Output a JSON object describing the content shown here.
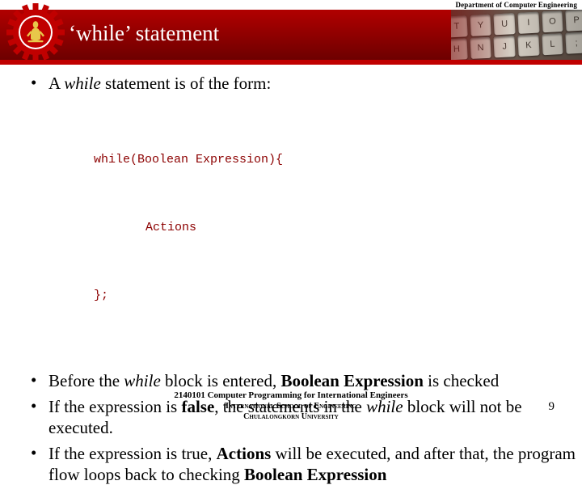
{
  "header": {
    "department": "Department of Computer Engineering",
    "title": "‘while’ statement",
    "keyboard_keys_row1": [
      "T",
      "Y",
      "U",
      "I",
      "O",
      "P"
    ],
    "keyboard_keys_row2": [
      "H",
      "N",
      "J",
      "K",
      "L",
      ";"
    ],
    "band_color": "#8c0000",
    "underline_color": "#c00000"
  },
  "logo": {
    "name": "chulalongkorn-engineering-gear-logo",
    "gear_color": "#c00000",
    "figure_color": "#e8c84a"
  },
  "content": {
    "bullet1": {
      "pre": "A ",
      "em": "while",
      "post": " statement is of the form:"
    },
    "code": {
      "line1_keyword": "while",
      "line1_rest": "(Boolean Expression){",
      "line2": "Actions",
      "line3": "};",
      "color": "#8c0000"
    },
    "bullet2": {
      "p1": "Before the ",
      "em1": "while",
      "p2": " block is entered, ",
      "b1": "Boolean Expression",
      "p3": " is checked"
    },
    "bullet3": {
      "p1": "If the expression is ",
      "b1": "false",
      "p2": ", the statements in the ",
      "em1": "while",
      "p3": " block will not be executed."
    },
    "bullet4": {
      "p1": "If the expression is true, ",
      "b1": "Actions",
      "p2": " will be executed, and after that, the program flow loops back to checking ",
      "b2": "Boolean Expression"
    }
  },
  "footer": {
    "line1": "2140101 Computer Programming for International Engineers",
    "line2": "International School of Engineering",
    "line3": "Chulalongkorn University",
    "page_number": "9"
  }
}
